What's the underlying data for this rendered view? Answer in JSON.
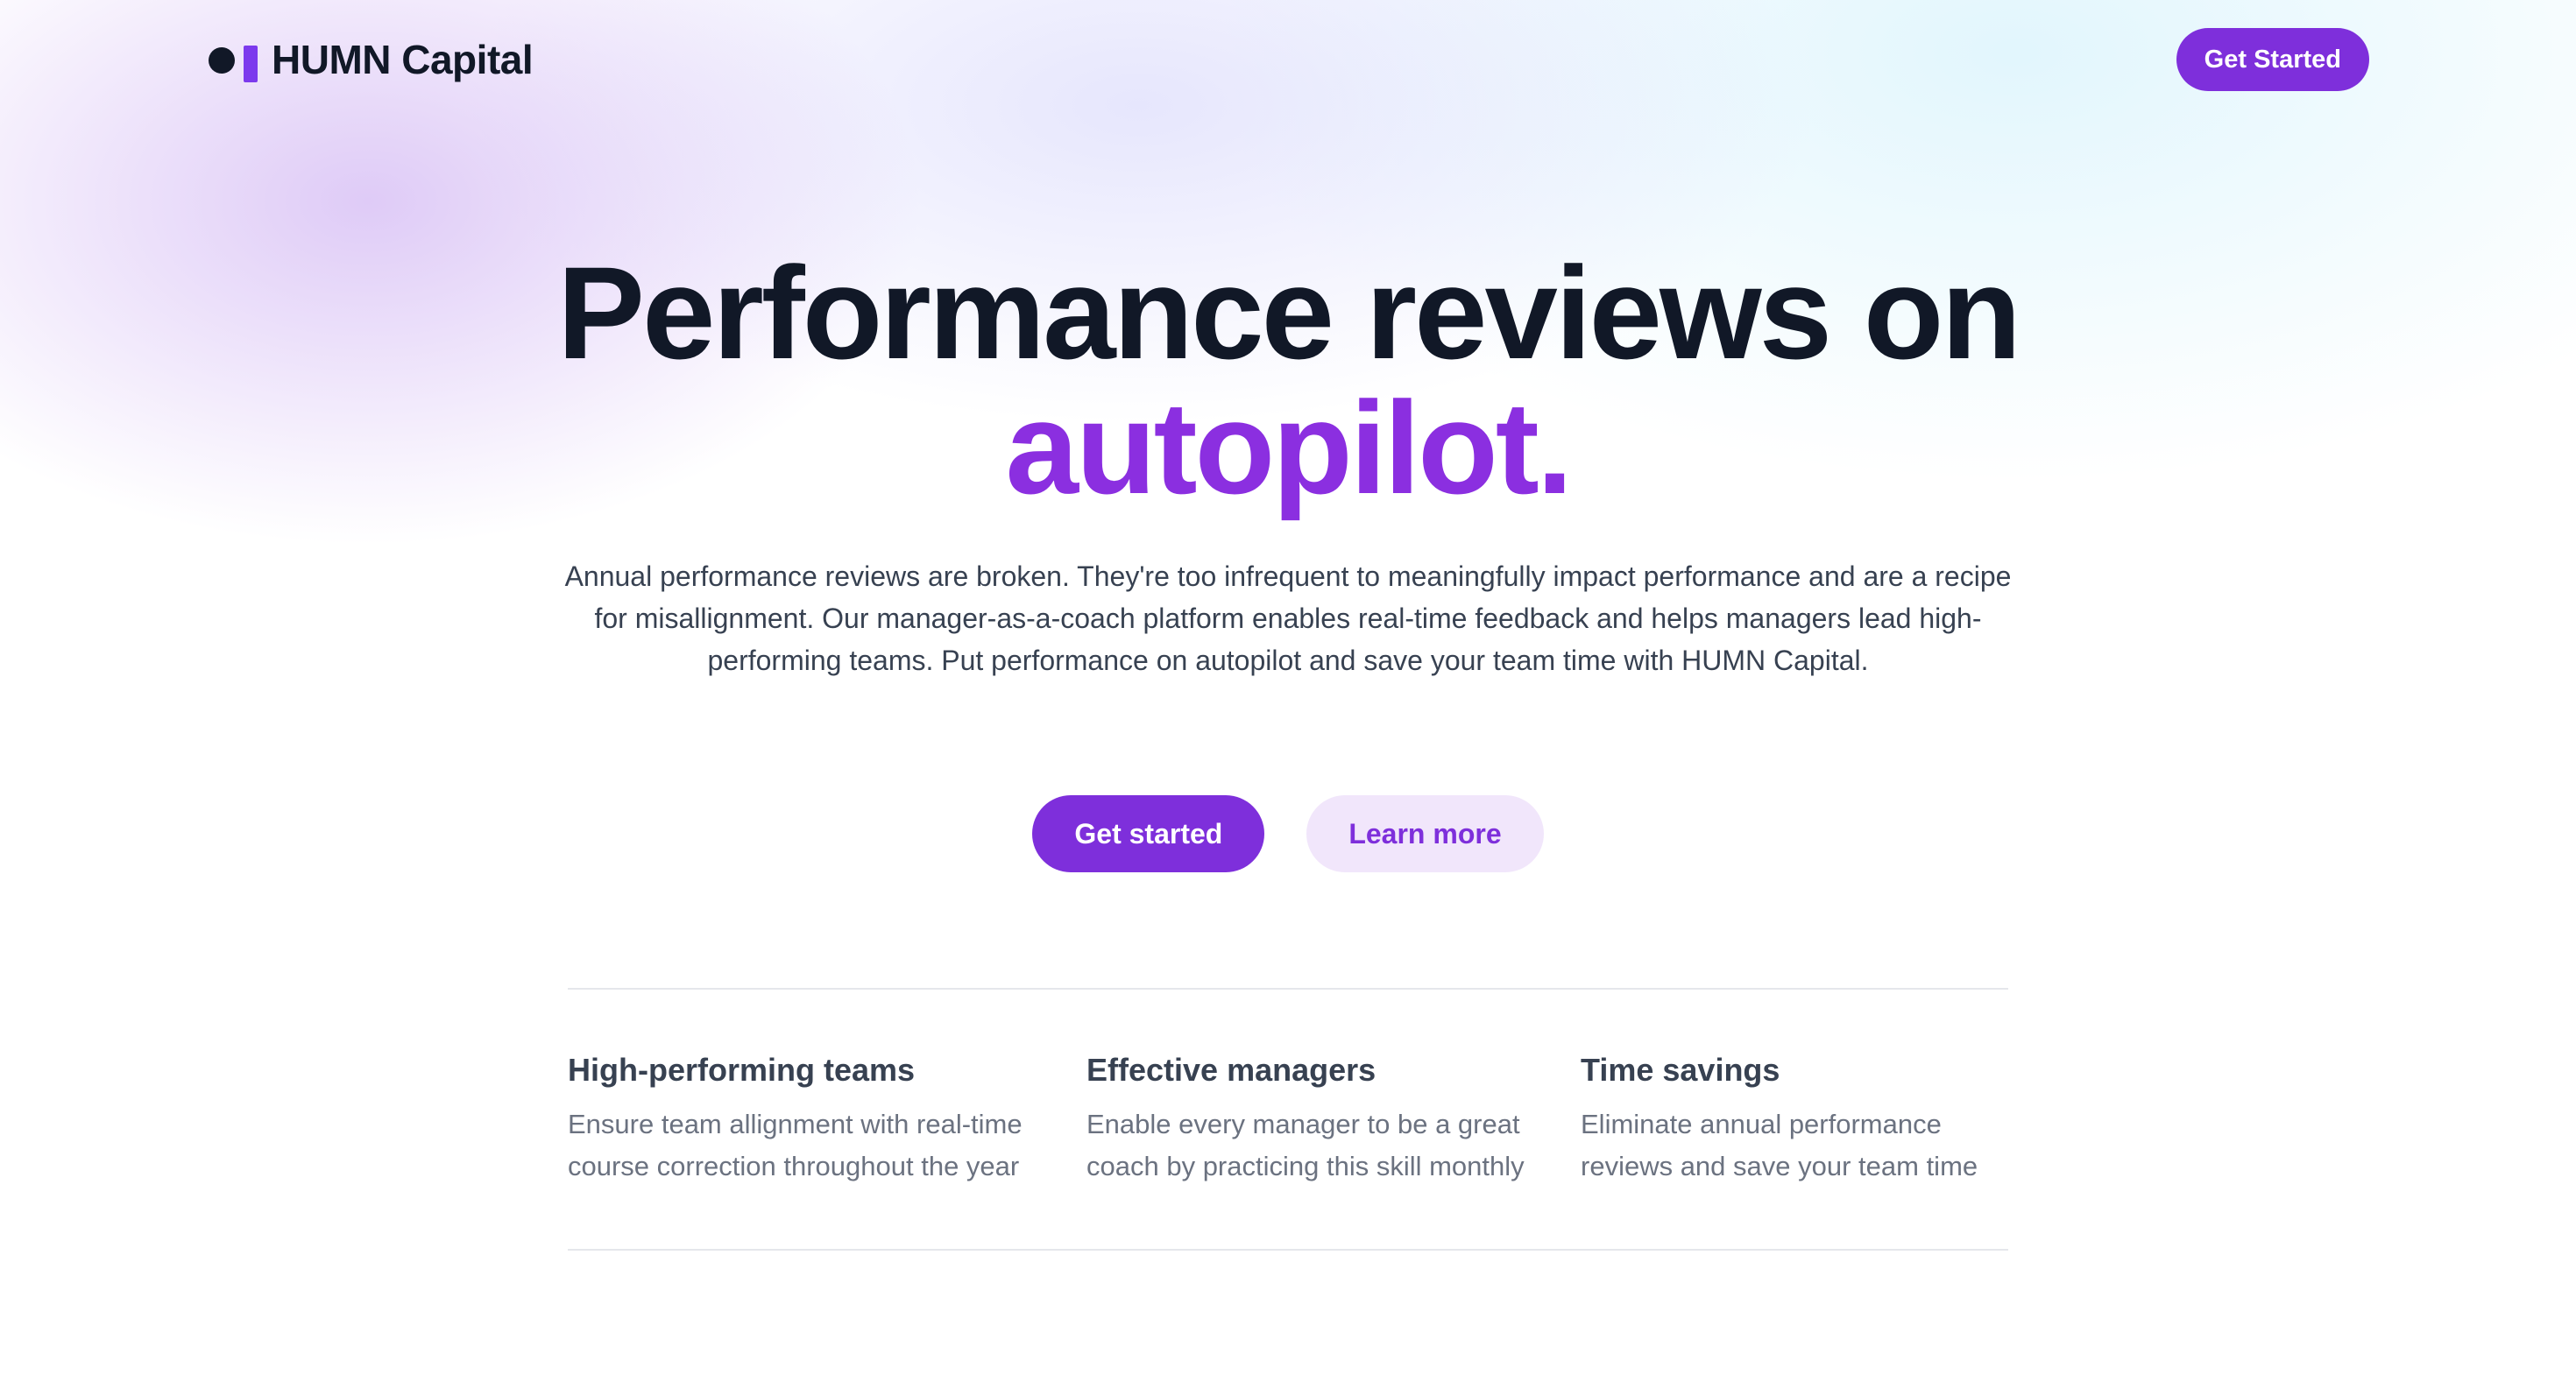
{
  "header": {
    "logo_text": "HUMN Capital",
    "cta_label": "Get Started"
  },
  "hero": {
    "title_main": "Performance reviews on",
    "title_accent": "autopilot.",
    "description": "Annual performance reviews are broken. They're too infrequent to meaningfully impact performance and are a recipe for misallignment. Our manager-as-a-coach platform enables real-time feedback and helps managers lead high-performing teams. Put performance on autopilot and save your team time with HUMN Capital.",
    "primary_cta": "Get started",
    "secondary_cta": "Learn more"
  },
  "features": [
    {
      "title": "High-performing teams",
      "text": "Ensure team allignment with real-time course correction throughout the year"
    },
    {
      "title": "Effective managers",
      "text": "Enable every manager to be a great coach by practicing this skill monthly"
    },
    {
      "title": "Time savings",
      "text": "Eliminate annual performance reviews and save your team time"
    }
  ],
  "colors": {
    "accent": "#7e2fdb",
    "accent_text": "#8b2fe0",
    "heading": "#111827",
    "secondary_button_bg": "#f1e6fb"
  },
  "icons": {
    "logo": "logo-mark-icon"
  }
}
